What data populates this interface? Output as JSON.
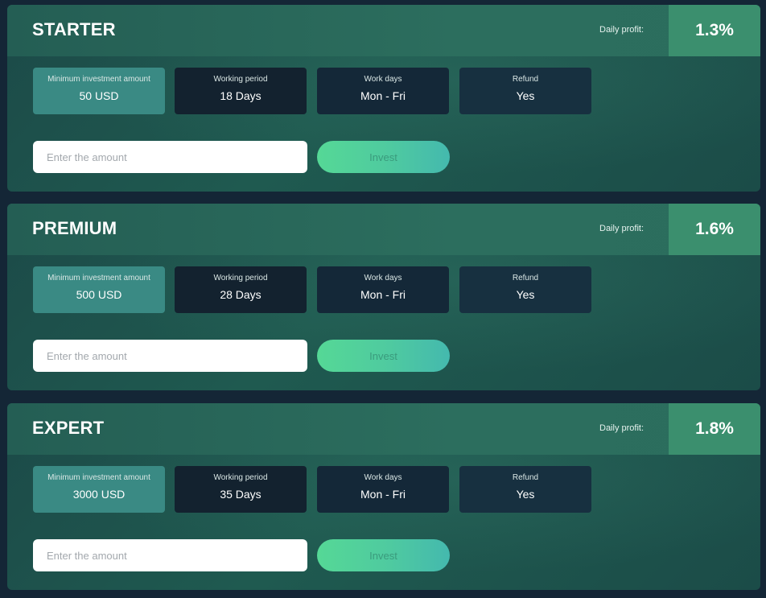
{
  "profit_label": "Daily profit:",
  "labels": {
    "min_investment": "Minimum investment amount",
    "working_period": "Working period",
    "work_days": "Work days",
    "refund": "Refund"
  },
  "input_placeholder": "Enter the amount",
  "invest_label": "Invest",
  "plans": [
    {
      "name": "STARTER",
      "daily_profit": "1.3%",
      "min_investment": "50 USD",
      "working_period": "18 Days",
      "work_days": "Mon - Fri",
      "refund": "Yes"
    },
    {
      "name": "PREMIUM",
      "daily_profit": "1.6%",
      "min_investment": "500 USD",
      "working_period": "28 Days",
      "work_days": "Mon - Fri",
      "refund": "Yes"
    },
    {
      "name": "EXPERT",
      "daily_profit": "1.8%",
      "min_investment": "3000 USD",
      "working_period": "35 Days",
      "work_days": "Mon - Fri",
      "refund": "Yes"
    }
  ],
  "colors": {
    "background": "#142636",
    "profit_box": "#3b8f6e",
    "min_investment_box": "#3a8a84",
    "invest_gradient_start": "#55d896",
    "invest_gradient_end": "#44b9ae"
  }
}
